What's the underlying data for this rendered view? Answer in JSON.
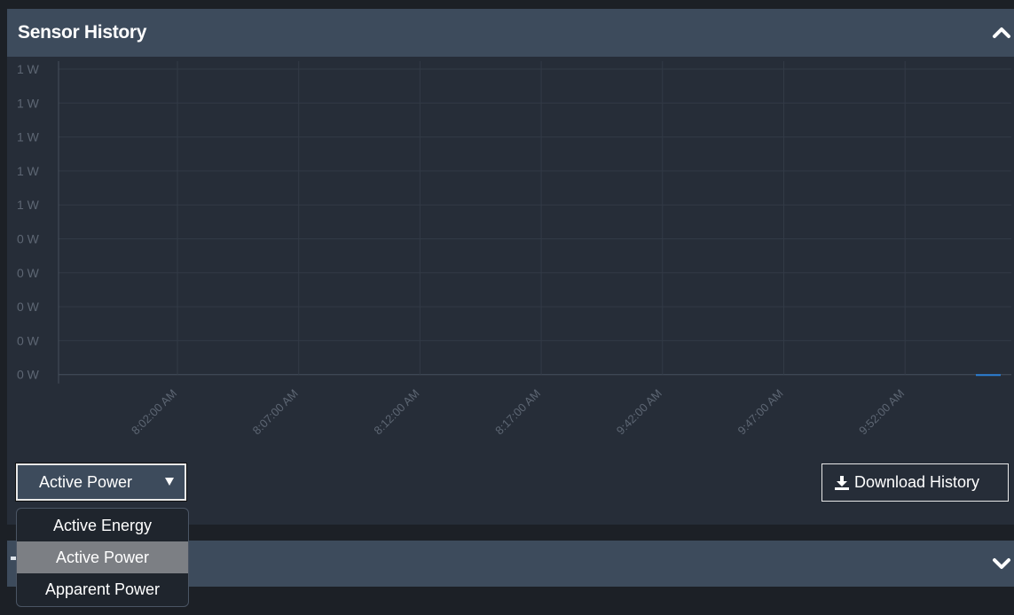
{
  "panel": {
    "title": "Sensor History",
    "collapse_icon": "chevron-up-icon"
  },
  "chart_data": {
    "type": "line",
    "y_tick_labels": [
      "1 W",
      "1 W",
      "1 W",
      "1 W",
      "1 W",
      "0 W",
      "0 W",
      "0 W",
      "0 W",
      "0 W"
    ],
    "x_tick_labels": [
      "8:02:00 AM",
      "8:07:00 AM",
      "8:12:00 AM",
      "8:17:00 AM",
      "9:42:00 AM",
      "9:47:00 AM",
      "9:52:00 AM"
    ],
    "series": [
      {
        "values": [
          0
        ],
        "color": "#2a7fd4"
      }
    ],
    "grid": true,
    "colors": {
      "grid": "#323a46",
      "axis": "#46505d",
      "label": "#5d6673"
    }
  },
  "controls": {
    "sensor_select": {
      "value": "Active Power",
      "caret_icon": "caret-down-icon"
    },
    "download_button": {
      "label": "Download History",
      "icon": "download-icon"
    }
  },
  "dropdown": {
    "options": [
      {
        "label": "Active Energy",
        "selected": false
      },
      {
        "label": "Active Power",
        "selected": true
      },
      {
        "label": "Apparent Power",
        "selected": false
      }
    ]
  },
  "lower_panel": {
    "expand_icon": "chevron-down-icon"
  }
}
